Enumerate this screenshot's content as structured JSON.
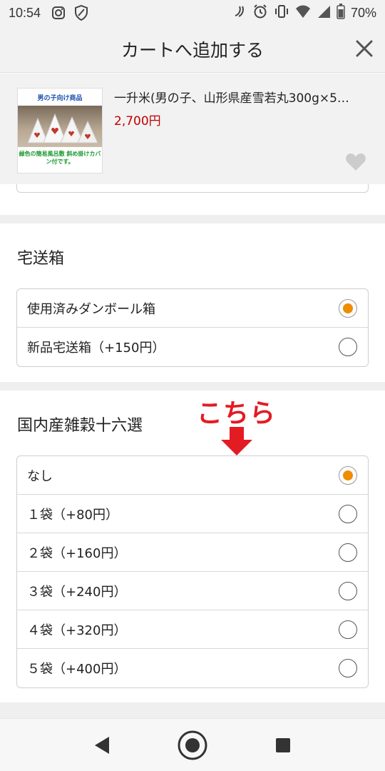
{
  "status_bar": {
    "time": "10:54",
    "battery": "70%"
  },
  "header": {
    "title": "カートへ追加する"
  },
  "product": {
    "name": "一升米(男の子、山形県産雪若丸300g×5…",
    "price": "2,700円",
    "thumbnail": {
      "top_text": "男の子向け商品",
      "bottom_text": "緑色の簡易風呂敷 斜め掛けカバン付です。"
    }
  },
  "sections": [
    {
      "title": "宅送箱",
      "options": [
        {
          "label": "使用済みダンボール箱",
          "selected": true
        },
        {
          "label": "新品宅送箱（+150円）",
          "selected": false
        }
      ]
    },
    {
      "title": "国内産雑穀十六選",
      "options": [
        {
          "label": "なし",
          "selected": true
        },
        {
          "label": "１袋（+80円）",
          "selected": false
        },
        {
          "label": "２袋（+160円）",
          "selected": false
        },
        {
          "label": "３袋（+240円）",
          "selected": false
        },
        {
          "label": "４袋（+320円）",
          "selected": false
        },
        {
          "label": "５袋（+400円）",
          "selected": false
        }
      ]
    }
  ],
  "annotation": {
    "text": "こちら"
  },
  "colors": {
    "accent": "#f08c00",
    "price": "#bf0000",
    "annotation": "#e31b23"
  },
  "icons": [
    "instagram-icon",
    "shield-icon",
    "nfc-icon",
    "alarm-icon",
    "vibrate-icon",
    "wifi-icon",
    "signal-icon",
    "battery-icon",
    "close-icon",
    "heart-icon",
    "back-icon",
    "home-icon",
    "recents-icon"
  ]
}
